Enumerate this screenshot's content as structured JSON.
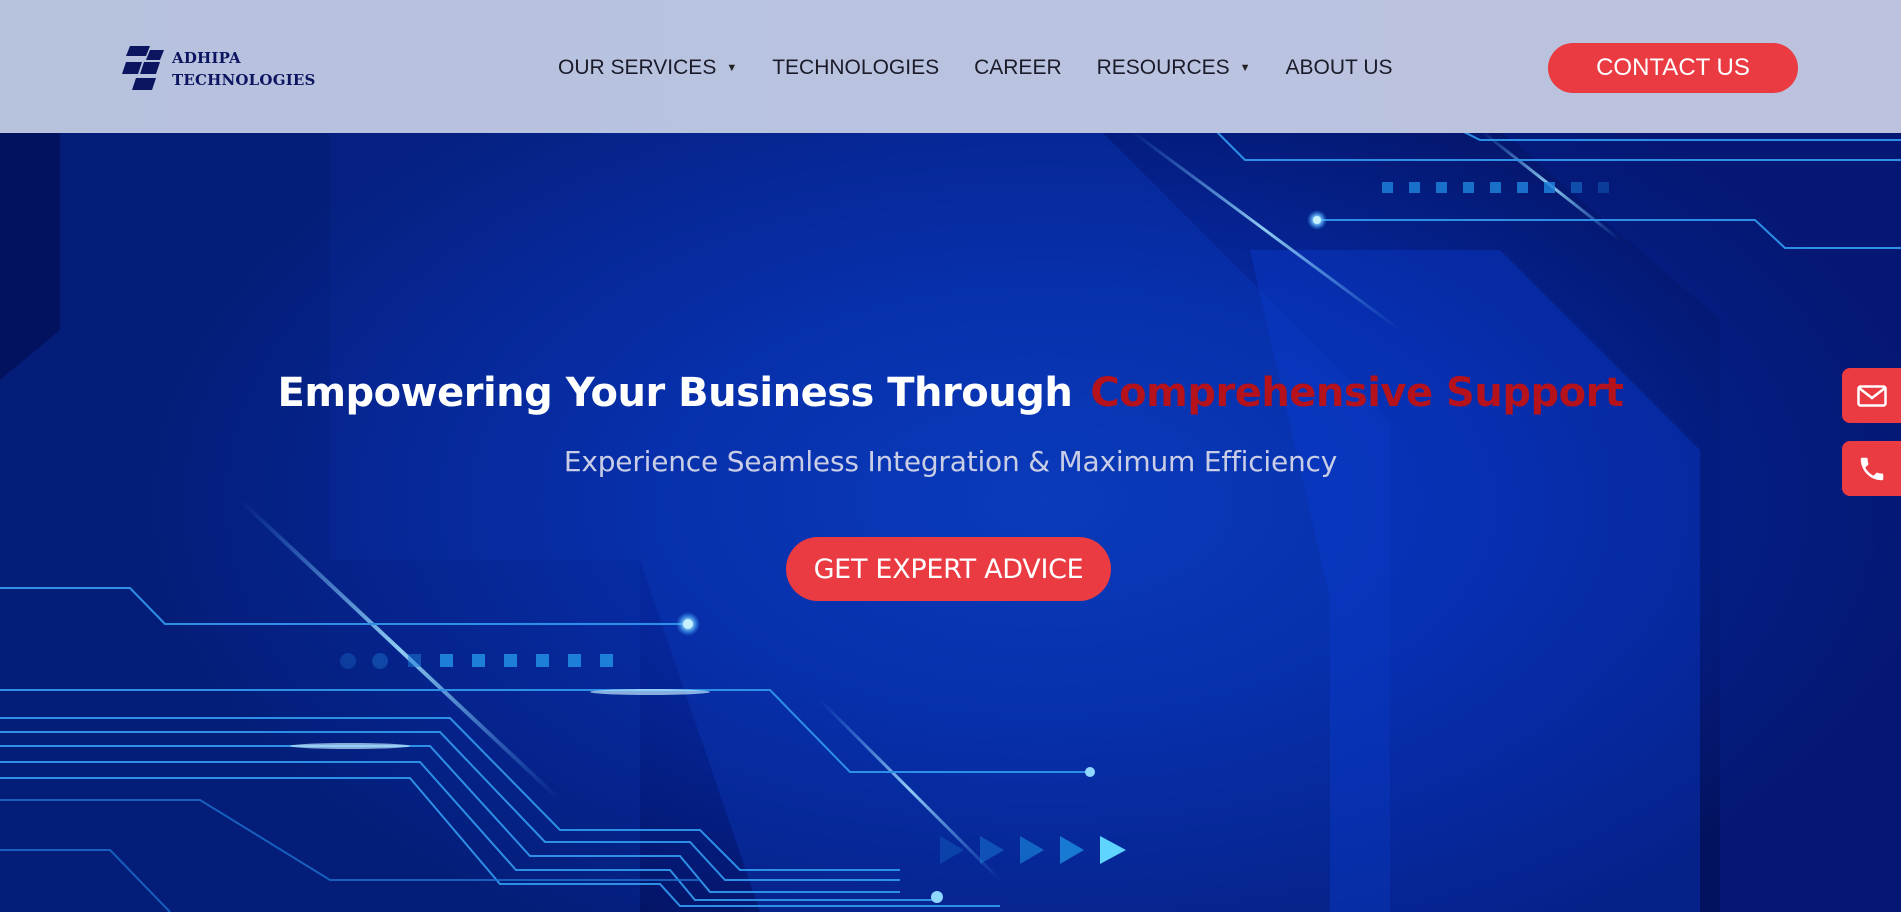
{
  "brand": {
    "name_line1": "ADHIPA",
    "name_line2": "TECHNOLOGIES",
    "logo_icon": "stacked-parallelogram-logo",
    "color": "#0c1560"
  },
  "nav": {
    "items": [
      {
        "label": "OUR SERVICES",
        "has_dropdown": true
      },
      {
        "label": "TECHNOLOGIES",
        "has_dropdown": false
      },
      {
        "label": "CAREER",
        "has_dropdown": false
      },
      {
        "label": "RESOURCES",
        "has_dropdown": true
      },
      {
        "label": "ABOUT US",
        "has_dropdown": false
      }
    ],
    "dropdown_icon": "caret-down-icon"
  },
  "header": {
    "contact_label": "CONTACT US"
  },
  "hero": {
    "headline_part1": "Empowering Your Business Through",
    "headline_part2": "Comprehensive Support",
    "subheadline": "Experience Seamless Integration & Maximum Efficiency",
    "cta_label": "GET EXPERT ADVICE"
  },
  "side_actions": [
    {
      "icon": "mail-icon"
    },
    {
      "icon": "phone-icon"
    }
  ],
  "colors": {
    "accent": "#ea3b43",
    "headline_highlight": "#b5121b",
    "hero_background": "#0629a0",
    "header_background": "#b9c3e0"
  }
}
